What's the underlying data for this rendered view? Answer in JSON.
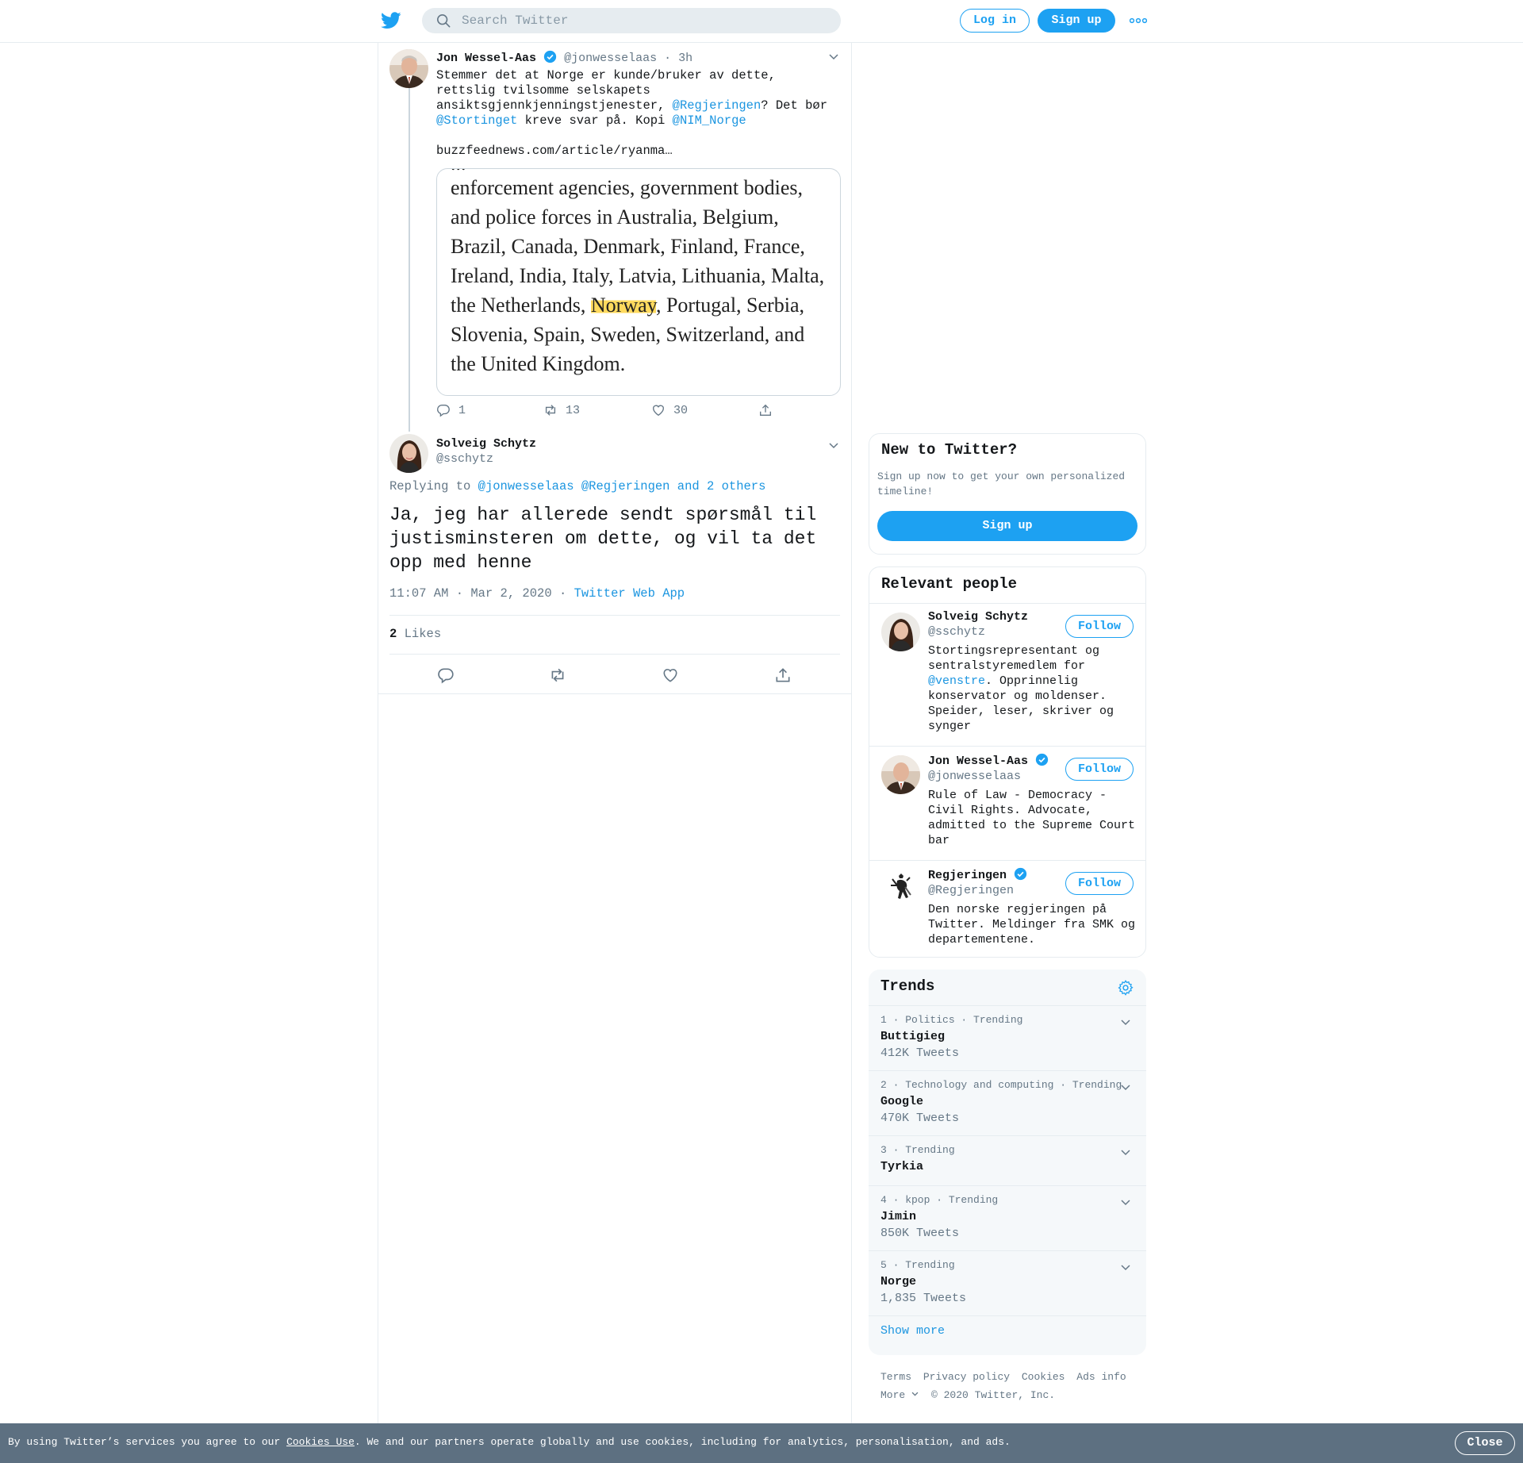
{
  "header": {
    "search_placeholder": "Search Twitter",
    "login_label": "Log in",
    "signup_label": "Sign up",
    "more_icon": "more-dots-icon"
  },
  "parent_tweet": {
    "name": "Jon Wessel-Aas",
    "handle": "@jonwesselaas",
    "time": "3h",
    "text_parts": {
      "a": "Stemmer det at Norge er kunde/bruker av dette, rettslig tvilsomme selskapets ansiktsgjennkjenningstjenester, ",
      "m1": "@Regjeringen",
      "b": "? Det bør ",
      "m2": "@Stortinget",
      "c": " kreve svar på. Kopi ",
      "m3": "@NIM_Norge"
    },
    "link": "buzzfeednews.com/article/ryanma…",
    "quote_image": {
      "line0": "...",
      "text_before": "enforcement agencies, government bodies, and police forces in Australia, Belgium, Brazil, Canada, Denmark, Finland, France, Ireland, India, Italy, Latvia, Lithuania, Malta, the Netherlands, ",
      "highlight": "Norway",
      "text_after": ", Portugal, Serbia, Slovenia, Spain, Sweden, Switzerland, and the United Kingdom."
    },
    "replies": "1",
    "retweets": "13",
    "likes": "30"
  },
  "main_tweet": {
    "name": "Solveig Schytz",
    "handle": "@sschytz",
    "replying_label": "Replying to",
    "replying_to": "@jonwesselaas @Regjeringen and 2 others",
    "text": "Ja, jeg har allerede sendt spørsmål til justisminsteren om dette, og vil ta det opp med henne",
    "timestamp": "11:07 AM · Mar 2, 2020",
    "source_sep": "·",
    "source": "Twitter Web App",
    "likes_count": "2",
    "likes_label": "Likes"
  },
  "new_to_twitter": {
    "title": "New to Twitter?",
    "subtitle": "Sign up now to get your own personalized timeline!",
    "signup_label": "Sign up"
  },
  "relevant_people": {
    "title": "Relevant people",
    "follow_label": "Follow",
    "people": [
      {
        "name": "Solveig Schytz",
        "handle": "@sschytz",
        "bio_a": "Stortingsrepresentant og sentralstyremedlem for ",
        "bio_link": "@venstre",
        "bio_b": ". Opprinnelig konservator og moldenser. Speider, leser, skriver og synger"
      },
      {
        "name": "Jon Wessel-Aas",
        "handle": "@jonwesselaas",
        "bio": "Rule of Law - Democracy - Civil Rights. Advocate, admitted to the Supreme Court bar"
      },
      {
        "name": "Regjeringen",
        "handle": "@Regjeringen",
        "bio": "Den norske regjeringen på Twitter. Meldinger fra SMK og departementene."
      }
    ]
  },
  "trends": {
    "title": "Trends",
    "items": [
      {
        "meta": "1 · Politics · Trending",
        "name": "Buttigieg",
        "count": "412K Tweets"
      },
      {
        "meta": "2 · Technology and computing · Trending",
        "name": "Google",
        "count": "470K Tweets"
      },
      {
        "meta": "3 · Trending",
        "name": "Tyrkia",
        "count": ""
      },
      {
        "meta": "4 · kpop · Trending",
        "name": "Jimin",
        "count": "850K Tweets"
      },
      {
        "meta": "5 · Trending",
        "name": "Norge",
        "count": "1,835 Tweets"
      }
    ],
    "show_more": "Show more"
  },
  "footer": {
    "terms": "Terms",
    "privacy": "Privacy policy",
    "cookies": "Cookies",
    "ads": "Ads info",
    "more": "More",
    "copyright": "© 2020 Twitter, Inc."
  },
  "cookie_bar": {
    "text_a": "By using Twitter’s services you agree to our ",
    "link": "Cookies Use",
    "text_b": ". We and our partners operate globally and use cookies, including for analytics, personalisation, and ads.",
    "close": "Close"
  },
  "colors": {
    "accent": "#1da1f2",
    "link": "#1b95e0",
    "muted": "#657786",
    "cookie_bar": "#5d7081"
  }
}
